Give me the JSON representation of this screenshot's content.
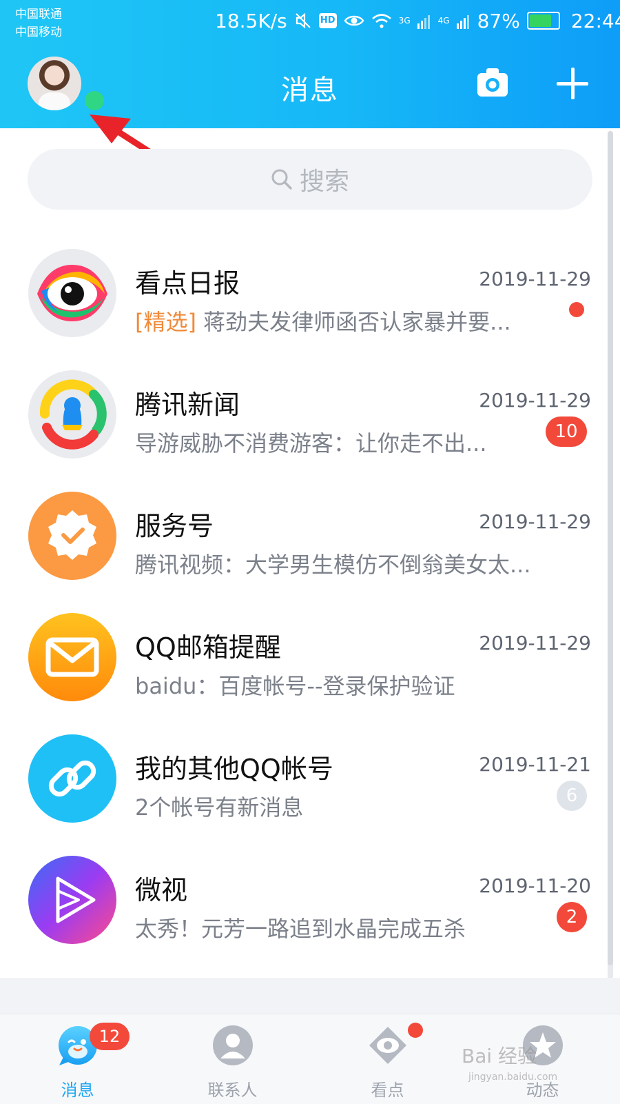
{
  "status_bar": {
    "carrier_1": "中国联通",
    "carrier_2": "中国移动",
    "net_speed": "18.5K/s",
    "hd_label": "HD",
    "net_3g": "3G",
    "net_4g": "4G",
    "battery_percent": "87%",
    "battery_level": 0.87,
    "time": "22:44"
  },
  "header": {
    "title": "消息",
    "online_color": "#2fd684",
    "icons": [
      "camera-icon",
      "plus-icon"
    ]
  },
  "search": {
    "placeholder": "搜索"
  },
  "conversations": [
    {
      "name": "看点日报",
      "date": "2019-11-29",
      "tag": "[精选]",
      "preview": " 蒋劲夫发律师函否认家暴并要...",
      "indicator": "dot"
    },
    {
      "name": "腾讯新闻",
      "date": "2019-11-29",
      "preview": "导游威胁不消费游客：让你走不出...",
      "badge": "10"
    },
    {
      "name": "服务号",
      "date": "2019-11-29",
      "preview": "腾讯视频：大学男生模仿不倒翁美女太..."
    },
    {
      "name": "QQ邮箱提醒",
      "date": "2019-11-29",
      "preview": "baidu：百度帐号--登录保护验证"
    },
    {
      "name": "我的其他QQ帐号",
      "date": "2019-11-21",
      "preview": "2个帐号有新消息",
      "badge": "6"
    },
    {
      "name": "微视",
      "date": "2019-11-20",
      "preview": "太秀！元芳一路追到水晶完成五杀",
      "badge": "2"
    }
  ],
  "tabbar": {
    "tabs": [
      {
        "label": "消息",
        "badge": "12",
        "active": true
      },
      {
        "label": "联系人"
      },
      {
        "label": "看点",
        "indicator": "dot"
      },
      {
        "label": "动态"
      }
    ]
  },
  "watermark": {
    "main": "Bai 经验",
    "sub": "jingyan.baidu.com"
  },
  "colors": {
    "header_gradient_start": "#1fc6f5",
    "header_gradient_end": "#0e9df8",
    "badge_red": "#f2493b",
    "tag_orange": "#f08a3a",
    "active_tab": "#1ea7f2"
  }
}
